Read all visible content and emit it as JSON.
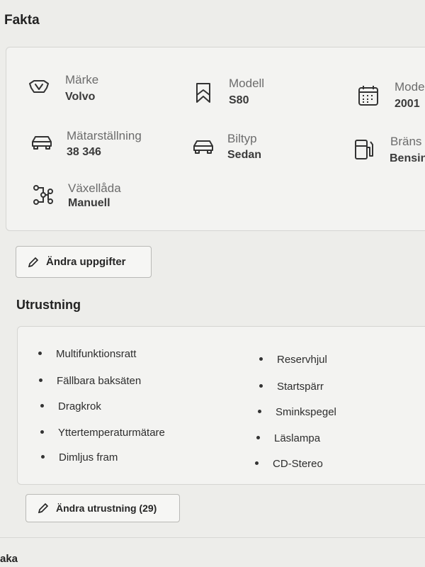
{
  "fakta": {
    "title": "Fakta",
    "items": [
      {
        "label": "Märke",
        "value": "Volvo",
        "icon": "car-front-icon"
      },
      {
        "label": "Modell",
        "value": "S80",
        "icon": "bookmark-icon"
      },
      {
        "label": "Mode",
        "value": "2001",
        "icon": "calendar-icon"
      },
      {
        "label": "Mätarställning",
        "value": "38 346",
        "icon": "car-icon"
      },
      {
        "label": "Biltyp",
        "value": "Sedan",
        "icon": "car-icon"
      },
      {
        "label": "Bräns",
        "value": "Bensin",
        "icon": "fuel-pump-icon"
      },
      {
        "label": "Växellåda",
        "value": "Manuell",
        "icon": "gearbox-icon"
      }
    ],
    "edit_button": "Ändra uppgifter"
  },
  "utrustning": {
    "title": "Utrustning",
    "left": [
      "Multifunktionsratt",
      "Fällbara baksäten",
      "Dragkrok",
      "Yttertemperaturmätare",
      "Dimljus fram"
    ],
    "right": [
      "Reservhjul",
      "Startspärr",
      "Sminkspegel",
      "Läslampa",
      "CD-Stereo"
    ],
    "edit_button": "Ändra utrustning (29)"
  },
  "bottom": {
    "partial_heading": "aka"
  }
}
